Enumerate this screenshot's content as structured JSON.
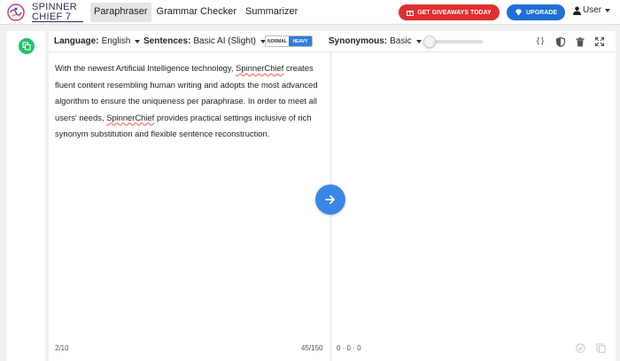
{
  "header": {
    "logo": {
      "line1": "SPINNER",
      "line2": "CHIEF 7"
    },
    "nav": [
      {
        "label": "Paraphraser",
        "active": true
      },
      {
        "label": "Grammar Checker",
        "active": false
      },
      {
        "label": "Summarizer",
        "active": false
      }
    ],
    "giveaways_label": "GET GIVEAWAYS TODAY",
    "upgrade_label": "UPGRADE",
    "user_label": "User"
  },
  "toolbar": {
    "language_label": "Language:",
    "language_value": "English",
    "sentences_label": "Sentences:",
    "sentences_value": "Basic AI (Slight)",
    "mode_normal": "NORMAL",
    "mode_heavy": "HEAVY",
    "synonymous_label": "Synonymous:",
    "synonymous_value": "Basic",
    "synonym_level": 0
  },
  "editor": {
    "text_parts": [
      {
        "t": "With the newest Artificial Intelligence technology, ",
        "u": false
      },
      {
        "t": "SpinnerChief",
        "u": true
      },
      {
        "t": " creates fluent content resembling human writing and adopts the most advanced algorithm to ensure the uniqueness per paraphrase. In order to meet all users' needs, ",
        "u": false
      },
      {
        "t": "SpinnerChief",
        "u": true
      },
      {
        "t": " provides practical settings inclusive of rich synonym substitution and flexible sentence reconstruction.",
        "u": false
      }
    ],
    "sentence_count": "2/10",
    "word_count": "45/150",
    "output_stats": "0 · 0 · 0"
  },
  "colors": {
    "giveaways": "#e02f2f",
    "upgrade": "#1f6fd6",
    "go_button": "#3a86e8",
    "side_icon": "#22c26a"
  }
}
